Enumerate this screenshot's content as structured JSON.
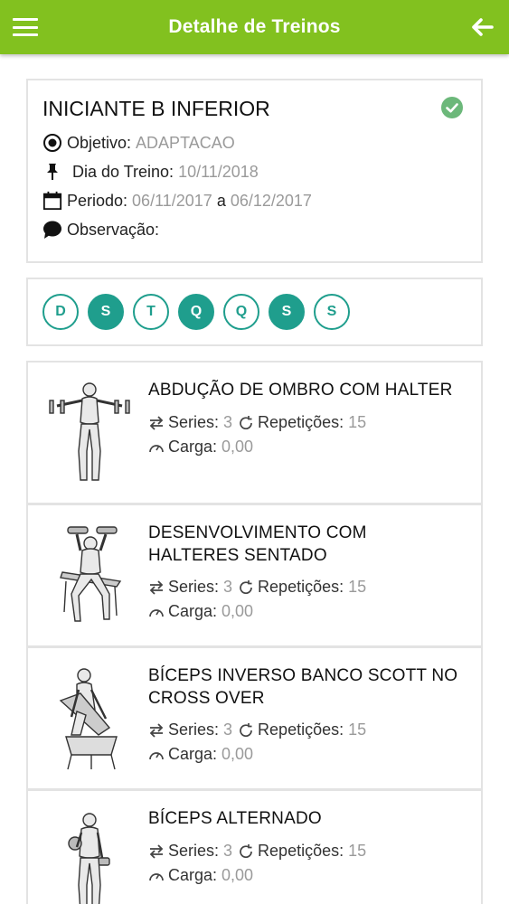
{
  "header": {
    "title": "Detalhe de Treinos",
    "menu_icon": "hamburger-menu-icon",
    "back_icon": "arrow-left-icon",
    "background_color": "#82c11f"
  },
  "workout": {
    "name": "INICIANTE B INFERIOR",
    "status_icon": "check-circle-icon",
    "objective_label": "Objetivo:",
    "objective_value": "ADAPTACAO",
    "day_label": "Dia do Treino:",
    "day_value": "10/11/2018",
    "period_label": "Periodo:",
    "period_start": "06/11/2017",
    "period_sep": "a",
    "period_end": "06/12/2017",
    "notes_label": "Observação:"
  },
  "days": [
    {
      "letter": "D",
      "active": false
    },
    {
      "letter": "S",
      "active": true
    },
    {
      "letter": "T",
      "active": false
    },
    {
      "letter": "Q",
      "active": true
    },
    {
      "letter": "Q",
      "active": false
    },
    {
      "letter": "S",
      "active": true
    },
    {
      "letter": "S",
      "active": false
    }
  ],
  "accent_color": "#1f9e8d",
  "exercises": [
    {
      "name_lines": [
        "ABDUÇÃO DE OMBRO COM HALTER"
      ],
      "series_label": "Series:",
      "series": "3",
      "reps_label": "Repetições:",
      "reps": "15",
      "load_label": "Carga:",
      "load": "0,00"
    },
    {
      "name_lines": [
        "DESENVOLVIMENTO COM",
        "HALTERES SENTADO"
      ],
      "series_label": "Series:",
      "series": "3",
      "reps_label": "Repetições:",
      "reps": "15",
      "load_label": "Carga:",
      "load": "0,00"
    },
    {
      "name_lines": [
        "BÍCEPS INVERSO BANCO SCOTT NO",
        "CROSS OVER"
      ],
      "series_label": "Series:",
      "series": "3",
      "reps_label": "Repetições:",
      "reps": "15",
      "load_label": "Carga:",
      "load": "0,00"
    },
    {
      "name_lines": [
        "BÍCEPS ALTERNADO"
      ],
      "series_label": "Series:",
      "series": "3",
      "reps_label": "Repetições:",
      "reps": "15",
      "load_label": "Carga:",
      "load": "0,00"
    }
  ]
}
